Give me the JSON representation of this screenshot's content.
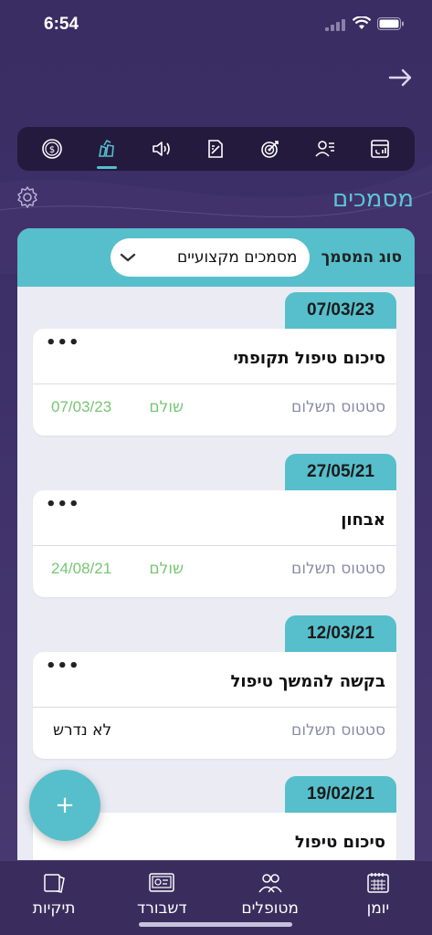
{
  "status_bar": {
    "time": "6:54"
  },
  "page": {
    "title": "מסמכים"
  },
  "filter": {
    "label": "סוג המסמך",
    "selected": "מסמכים מקצועיים"
  },
  "documents": [
    {
      "date": "07/03/23",
      "title": "סיכום טיפול תקופתי",
      "payment_label": "סטטוס תשלום",
      "payment_status": "שולם",
      "payment_date": "07/03/23"
    },
    {
      "date": "27/05/21",
      "title": "אבחון",
      "payment_label": "סטטוס תשלום",
      "payment_status": "שולם",
      "payment_date": "24/08/21"
    },
    {
      "date": "12/03/21",
      "title": "בקשה להמשך טיפול",
      "payment_label": "סטטוס תשלום",
      "payment_status": "לא נדרש"
    },
    {
      "date": "19/02/21",
      "title": "סיכום טיפול"
    }
  ],
  "fab": {
    "label": "+"
  },
  "bottom_nav": [
    {
      "label": "תיקיות",
      "icon": "folders-icon"
    },
    {
      "label": "דשבורד",
      "icon": "dashboard-icon"
    },
    {
      "label": "מטופלים",
      "icon": "patients-icon"
    },
    {
      "label": "יומן",
      "icon": "calendar-icon"
    }
  ],
  "colors": {
    "accent": "#56bfcb",
    "background": "#3a2d63",
    "paid": "#76c672",
    "toolbar": "#241a3d"
  }
}
